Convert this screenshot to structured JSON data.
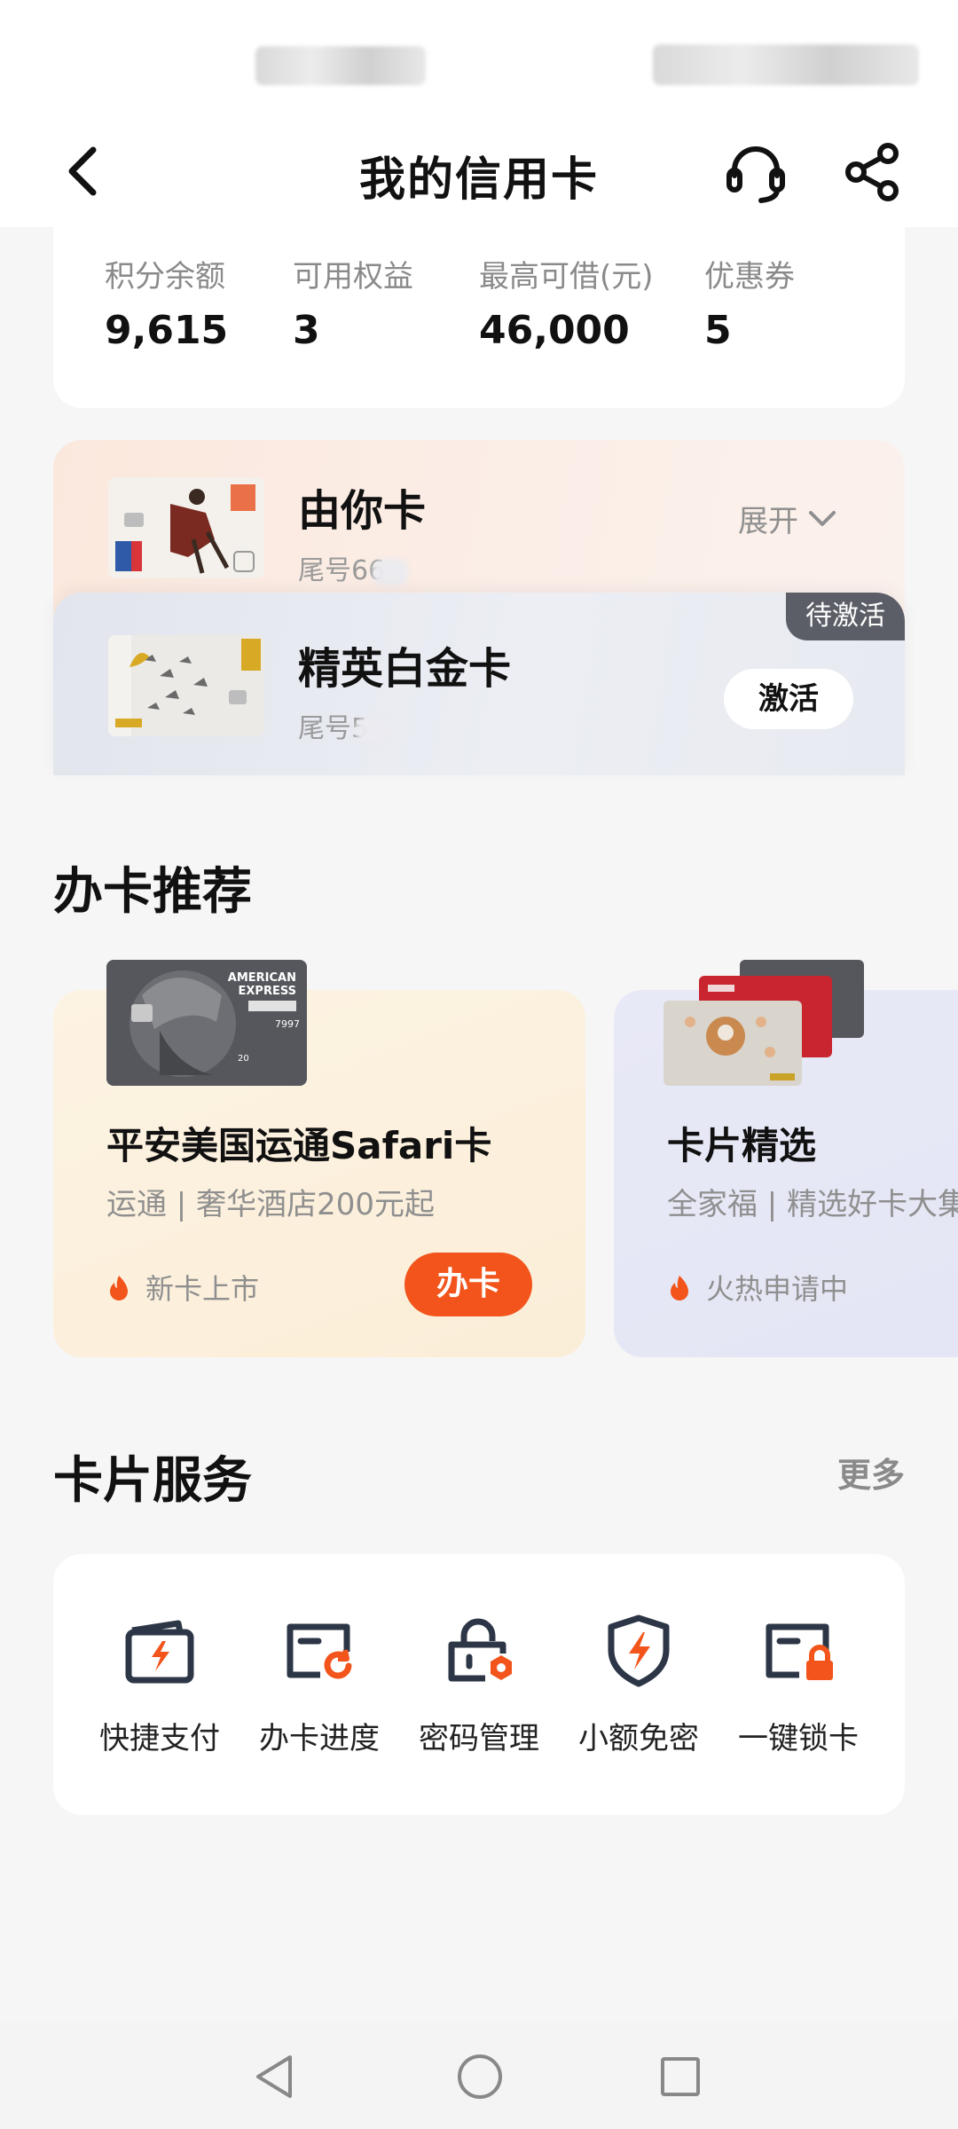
{
  "header": {
    "title": "我的信用卡",
    "back_icon": "back-icon",
    "support_icon": "headset-icon",
    "share_icon": "share-icon"
  },
  "stats": [
    {
      "label": "积分余额",
      "value": "9,615"
    },
    {
      "label": "可用权益",
      "value": "3"
    },
    {
      "label": "最高可借(元)",
      "value": "46,000"
    },
    {
      "label": "优惠券",
      "value": "5"
    }
  ],
  "owned_cards": [
    {
      "name": "由你卡",
      "tail": "尾号66",
      "action": "展开"
    },
    {
      "name": "精英白金卡",
      "tail": "尾号5",
      "badge": "待激活",
      "action": "激活"
    }
  ],
  "recommend": {
    "title": "办卡推荐",
    "cards": [
      {
        "name": "平安美国运通Safari卡",
        "desc": "运通 | 奢华酒店200元起",
        "tag": "新卡上市",
        "button": "办卡",
        "card_text": {
          "brand_line1": "AMERICAN",
          "brand_line2": "EXPRESS",
          "number": "7997",
          "seq": "20"
        }
      },
      {
        "name": "卡片精选",
        "desc": "全家福 | 精选好卡大集",
        "tag": "火热申请中"
      }
    ]
  },
  "services": {
    "title": "卡片服务",
    "more": "更多",
    "items": [
      {
        "label": "快捷支付",
        "icon": "wallet-bolt-icon"
      },
      {
        "label": "办卡进度",
        "icon": "card-progress-icon"
      },
      {
        "label": "密码管理",
        "icon": "lock-gear-icon"
      },
      {
        "label": "小额免密",
        "icon": "shield-bolt-icon"
      },
      {
        "label": "一键锁卡",
        "icon": "card-lock-icon"
      }
    ]
  },
  "colors": {
    "accent": "#f2541b",
    "icon_dark": "#2c3646",
    "badge": "#5b5e66",
    "background": "#f6f6f6"
  }
}
